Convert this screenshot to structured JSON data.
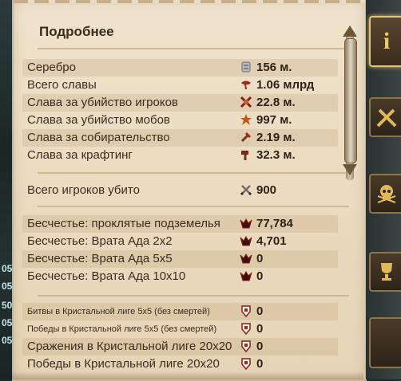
{
  "window": {
    "title": "Подробнее"
  },
  "left_hud": {
    "numbers": [
      "05",
      "05",
      "50",
      "05",
      "05"
    ]
  },
  "sections": {
    "fame": [
      {
        "label": "Серебро",
        "icon": "silver-coin-icon",
        "value": "156 м."
      },
      {
        "label": "Всего славы",
        "icon": "fame-icon",
        "value": "1.06 млрд"
      },
      {
        "label": "Слава за убийство игроков",
        "icon": "pvp-fame-icon",
        "value": "22.8 м."
      },
      {
        "label": "Слава за убийство мобов",
        "icon": "pve-fame-icon",
        "value": "997 м."
      },
      {
        "label": "Слава за собирательство",
        "icon": "gathering-fame-icon",
        "value": "2.19 м."
      },
      {
        "label": "Слава за крафтинг",
        "icon": "crafting-fame-icon",
        "value": "32.3 м."
      }
    ],
    "kills": [
      {
        "label": "Всего игроков убито",
        "icon": "crossed-swords-icon",
        "value": "900"
      }
    ],
    "infamy": [
      {
        "label": "Бесчестье: проклятые подземелья",
        "icon": "infamy-icon",
        "value": "77,784"
      },
      {
        "label": "Бесчестье: Врата Ада 2x2",
        "icon": "infamy-icon",
        "value": "4,701"
      },
      {
        "label": "Бесчестье: Врата Ада 5x5",
        "icon": "infamy-icon",
        "value": "0"
      },
      {
        "label": "Бесчестье: Врата Ада 10x10",
        "icon": "infamy-icon",
        "value": "0"
      }
    ],
    "crystal": [
      {
        "label": "Битвы в Кристальной лиге 5x5 (без смертей)",
        "icon": "crystal-league-icon",
        "value": "0"
      },
      {
        "label": "Победы в Кристальной лиге 5x5 (без смертей)",
        "icon": "crystal-league-icon",
        "value": "0"
      },
      {
        "label": "Сражения в Кристальной лиге 20x20",
        "icon": "crystal-league-icon",
        "value": "0"
      },
      {
        "label": "Победы в Кристальной лиге 20x20",
        "icon": "crystal-league-icon",
        "value": "0"
      }
    ]
  },
  "side_tabs": [
    {
      "name": "info-tab",
      "icon": "info-icon",
      "letter": "i",
      "active": true
    },
    {
      "name": "combat-tab",
      "icon": "crossed-swords-icon"
    },
    {
      "name": "pvp-tab",
      "icon": "skull-icon"
    },
    {
      "name": "achievements-tab",
      "icon": "trophy-icon"
    }
  ],
  "colors": {
    "panel_bg": "#ecdfc6",
    "text": "#3b2c1e",
    "accent_gold": "#e3c476",
    "fame_red": "#a0281c"
  }
}
